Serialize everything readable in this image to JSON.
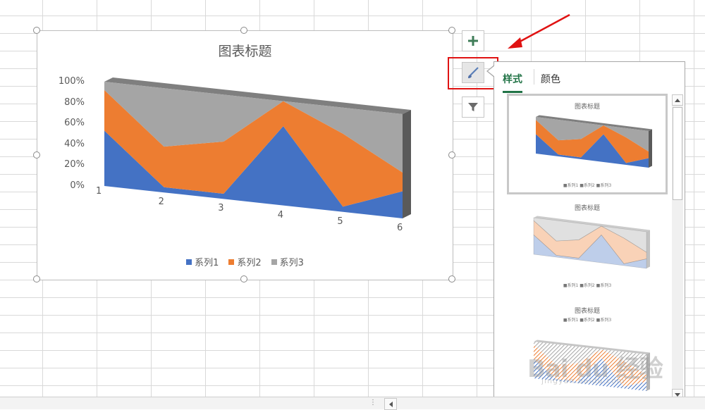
{
  "chart_data": {
    "type": "area",
    "subtype": "3d-100%-stacked-area",
    "title": "图表标题",
    "categories": [
      "1",
      "2",
      "3",
      "4",
      "5",
      "6"
    ],
    "y_ticks": [
      "0%",
      "20%",
      "40%",
      "60%",
      "80%",
      "100%"
    ],
    "ylim": [
      0,
      100
    ],
    "grid": false,
    "legend_position": "bottom",
    "series": [
      {
        "name": "系列1",
        "color": "#4472c4",
        "values": [
          53,
          5,
          5,
          76,
          5,
          26
        ]
      },
      {
        "name": "系列2",
        "color": "#ed7d31",
        "values": [
          39,
          39,
          50,
          24,
          70,
          18
        ]
      },
      {
        "name": "系列3",
        "color": "#a5a5a5",
        "values": [
          8,
          56,
          45,
          0,
          25,
          56
        ]
      }
    ]
  },
  "side_buttons": {
    "add_icon": "plus-icon",
    "style_icon": "brush-icon",
    "filter_icon": "funnel-icon"
  },
  "style_panel": {
    "tabs": [
      "样式",
      "颜色"
    ],
    "active_tab": "样式",
    "thumbs": [
      {
        "title": "图表标题",
        "legend": "■系列1  ■系列2  ■系列3"
      },
      {
        "title": "图表标题",
        "legend": "■系列1  ■系列2  ■系列3"
      },
      {
        "title": "图表标题",
        "legend": "■系列1  ■系列2  ■系列3"
      }
    ]
  },
  "watermark": {
    "main": "Bai du 经验",
    "sub": "jingyan.baidu.com"
  },
  "accent_colors": {
    "annotation_red": "#e01212",
    "tab_green": "#217346"
  }
}
